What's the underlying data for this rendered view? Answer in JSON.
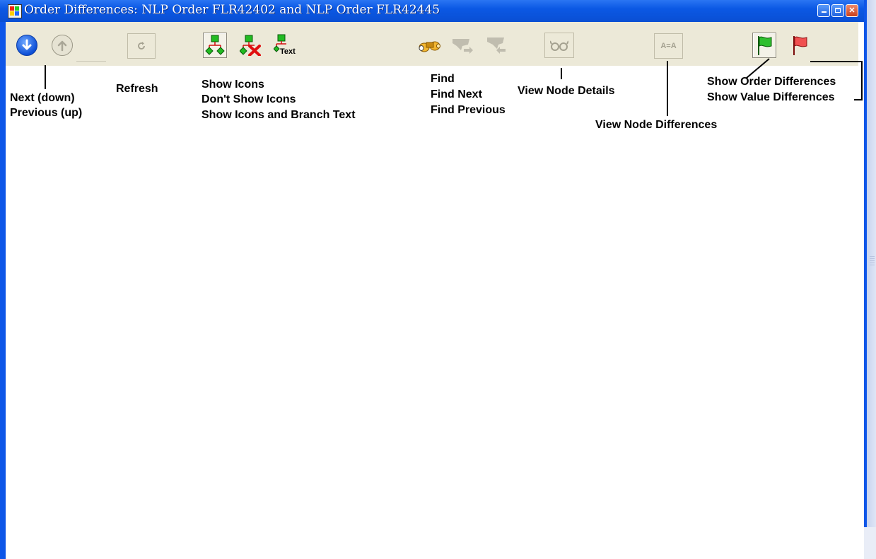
{
  "window": {
    "title": "Order Differences: NLP Order FLR42402 and NLP Order FLR42445"
  },
  "toolbar": {
    "buttons": [
      {
        "name": "next-down-button",
        "icon": "arrow-down-circle-icon"
      },
      {
        "name": "previous-up-button",
        "icon": "arrow-up-circle-icon"
      },
      {
        "name": "refresh-button",
        "icon": "refresh-icon"
      },
      {
        "name": "show-icons-button",
        "icon": "tree-icon"
      },
      {
        "name": "dont-show-icons-button",
        "icon": "tree-x-icon"
      },
      {
        "name": "show-icons-branch-text-button",
        "icon": "tree-text-icon",
        "glyph_text": "Text"
      },
      {
        "name": "find-button",
        "icon": "binoculars-icon"
      },
      {
        "name": "find-next-button",
        "icon": "find-next-icon"
      },
      {
        "name": "find-previous-button",
        "icon": "find-previous-icon"
      },
      {
        "name": "view-node-details-button",
        "icon": "glasses-icon"
      },
      {
        "name": "view-node-differences-button",
        "icon": "compare-icon",
        "glyph_text": "A=A"
      },
      {
        "name": "show-order-differences-button",
        "icon": "green-flag-icon"
      },
      {
        "name": "show-value-differences-button",
        "icon": "red-flag-icon"
      }
    ]
  },
  "annotations": {
    "next": "Next (down)",
    "previous": "Previous (up)",
    "refresh": "Refresh",
    "show_icons": "Show Icons",
    "dont_show_icons": "Don't Show Icons",
    "show_icons_branch": "Show Icons and Branch Text",
    "find": "Find",
    "find_next": "Find Next",
    "find_previous": "Find Previous",
    "view_node_details": "View Node Details",
    "view_node_differences": "View Node Differences",
    "show_order_differences": "Show Order Differences",
    "show_value_differences": "Show Value Differences"
  },
  "colors": {
    "titlebar": "#0b58e4",
    "toolbar": "#ece9d8",
    "green_node": "#22bb22",
    "red_x": "#e01010"
  }
}
